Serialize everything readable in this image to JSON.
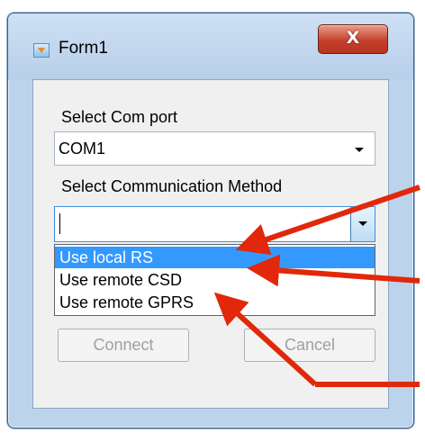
{
  "window": {
    "title": "Form1",
    "close_glyph": "X"
  },
  "form": {
    "com_port_label": "Select Com port",
    "com_port_value": "COM1",
    "method_label": "Select Communication Method",
    "method_value": "",
    "method_options": [
      "Use local RS",
      "Use remote CSD",
      "Use remote GPRS"
    ],
    "selected_option_index": 0
  },
  "buttons": {
    "connect": "Connect",
    "cancel": "Cancel"
  },
  "colors": {
    "selection": "#3399ff",
    "annotation_arrow": "#e1280a",
    "close_button": "#c5412c"
  }
}
